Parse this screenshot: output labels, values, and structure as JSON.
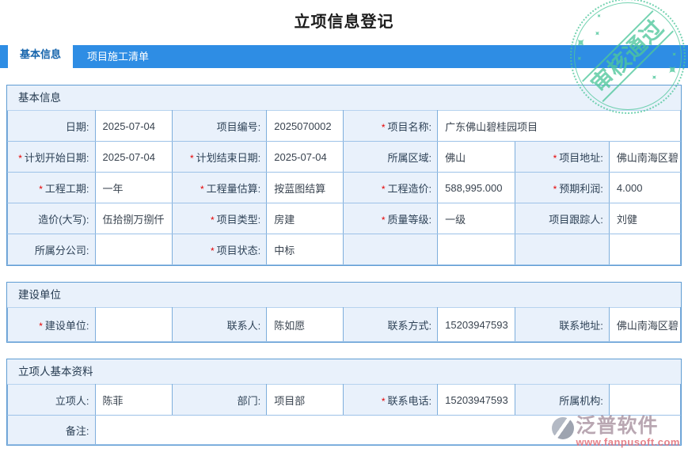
{
  "page": {
    "title": "立项信息登记"
  },
  "tabs": [
    {
      "label": "基本信息",
      "active": true
    },
    {
      "label": "项目施工清单",
      "active": false
    }
  ],
  "stamp": {
    "text": "审核通过",
    "star": "✦",
    "color": "#4fc79c"
  },
  "watermark": {
    "brand": "泛普软件",
    "url": "www.fanpusoft.com",
    "brand_color": "#9e8594",
    "url_color": "#e26c76"
  },
  "ui_colors": {
    "tabbar_blue": "#2e8de4",
    "panel_bg": "#e9f1fb",
    "panel_border": "#5f9cd3",
    "required_red": "#e60000"
  },
  "sections": {
    "basic": {
      "title": "基本信息",
      "fields": [
        {
          "req": "",
          "label": "日期:",
          "value": "2025-07-04"
        },
        {
          "req": "",
          "label": "项目编号:",
          "value": "2025070002"
        },
        {
          "req": "*",
          "label": "项目名称:",
          "value": "广东佛山碧桂园项目"
        },
        {
          "req": "*",
          "label": "计划开始日期:",
          "value": "2025-07-04"
        },
        {
          "req": "*",
          "label": "计划结束日期:",
          "value": "2025-07-04"
        },
        {
          "req": "",
          "label": "所属区域:",
          "value": "佛山"
        },
        {
          "req": "*",
          "label": "项目地址:",
          "value": "佛山南海区碧"
        },
        {
          "req": "*",
          "label": "工程工期:",
          "value": "一年"
        },
        {
          "req": "*",
          "label": "工程量估算:",
          "value": "按蓝图结算"
        },
        {
          "req": "*",
          "label": "工程造价:",
          "value": "588,995.000"
        },
        {
          "req": "*",
          "label": "预期利润:",
          "value": "4.000"
        },
        {
          "req": "",
          "label": "造价(大写):",
          "value": "伍拾捌万捌仟"
        },
        {
          "req": "*",
          "label": "项目类型:",
          "value": "房建"
        },
        {
          "req": "*",
          "label": "质量等级:",
          "value": "一级"
        },
        {
          "req": "",
          "label": "项目跟踪人:",
          "value": "刘健"
        },
        {
          "req": "",
          "label": "所属分公司:",
          "value": ""
        },
        {
          "req": "*",
          "label": "项目状态:",
          "value": "中标"
        }
      ]
    },
    "build": {
      "title": "建设单位",
      "fields": [
        {
          "req": "*",
          "label": "建设单位:",
          "value": ""
        },
        {
          "req": "",
          "label": "联系人:",
          "value": "陈如愿"
        },
        {
          "req": "",
          "label": "联系方式:",
          "value": "15203947593"
        },
        {
          "req": "",
          "label": "联系地址:",
          "value": "佛山南海区碧"
        }
      ]
    },
    "applicant": {
      "title": "立项人基本资料",
      "fields": [
        {
          "req": "",
          "label": "立项人:",
          "value": "陈菲"
        },
        {
          "req": "",
          "label": "部门:",
          "value": "项目部"
        },
        {
          "req": "*",
          "label": "联系电话:",
          "value": "15203947593"
        },
        {
          "req": "",
          "label": "所属机构:",
          "value": ""
        },
        {
          "req": "",
          "label": "备注:",
          "value": ""
        }
      ]
    }
  }
}
